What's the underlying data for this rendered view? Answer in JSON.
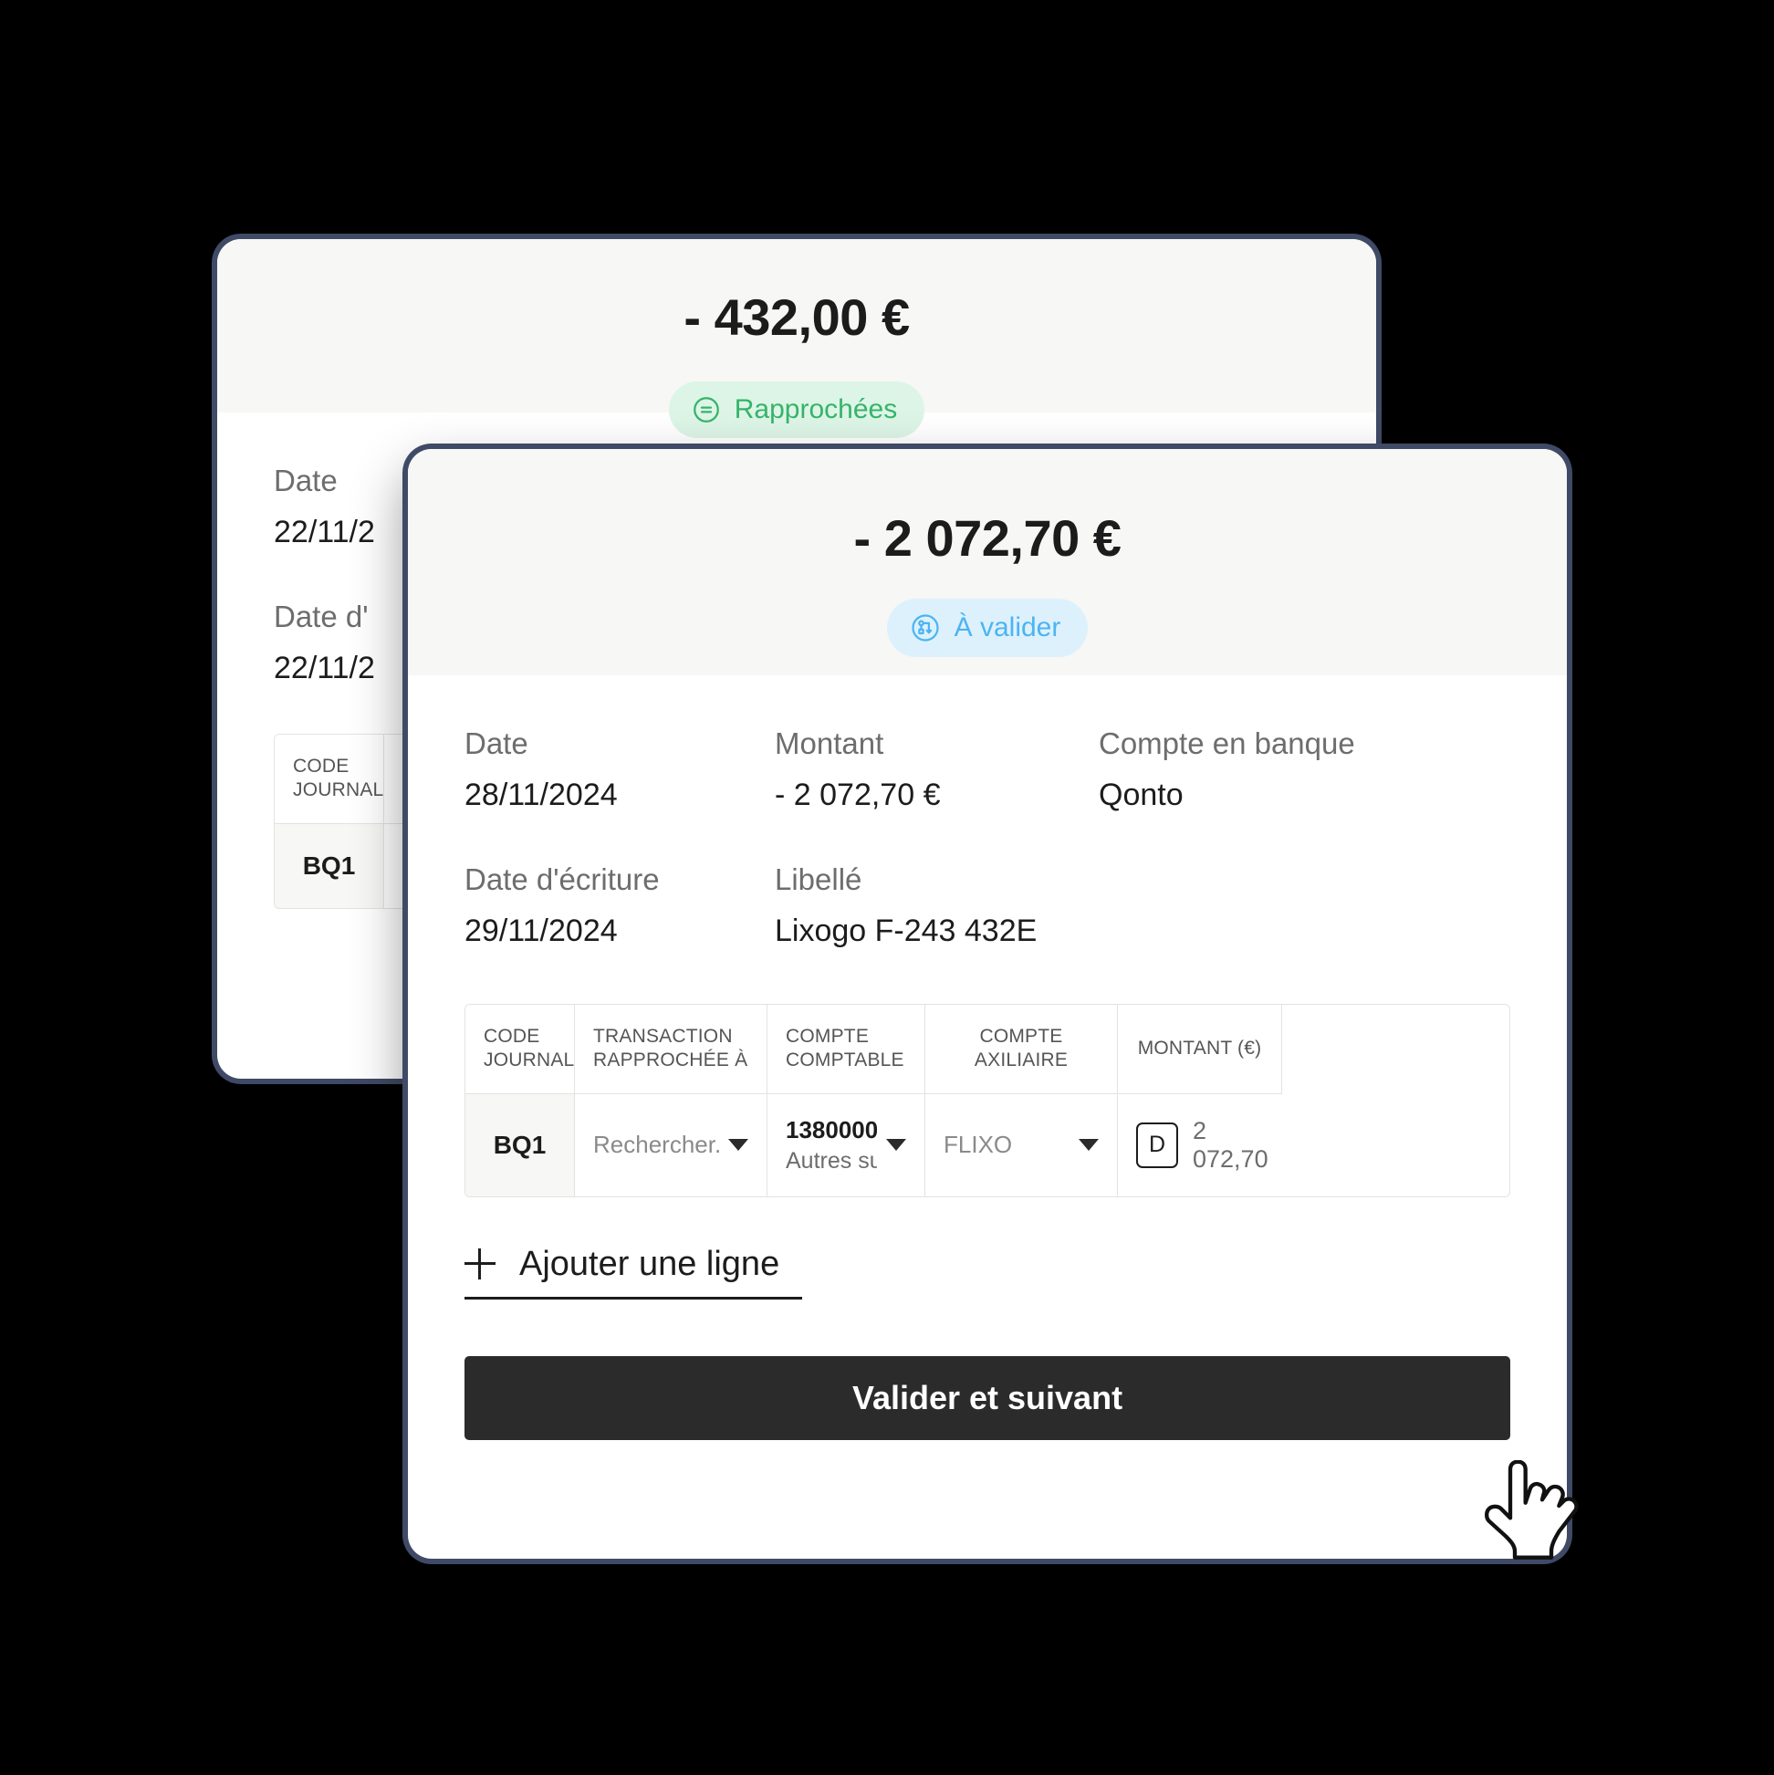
{
  "back_card": {
    "amount": "- 432,00 €",
    "status_badge": {
      "label": "Rapprochées",
      "icon": "equals-circle-icon",
      "color": "#36b46b",
      "bg": "#ddf5e6"
    },
    "fields": [
      {
        "label": "Date",
        "value": "22/11/2"
      },
      {
        "label": "Date d'",
        "value": "22/11/2"
      }
    ],
    "table": {
      "headers": [
        "CODE JOURNAL"
      ],
      "rows": [
        {
          "journal": "BQ1"
        }
      ]
    }
  },
  "front_card": {
    "amount": "- 2 072,70 €",
    "status_badge": {
      "label": "À valider",
      "icon": "workflow-circle-icon",
      "color": "#4cb4f2",
      "bg": "#ddf1fd"
    },
    "fields": [
      {
        "label": "Date",
        "value": "28/11/2024"
      },
      {
        "label": "Montant",
        "value": "- 2 072,70 €"
      },
      {
        "label": "Compte en banque",
        "value": "Qonto"
      },
      {
        "label": "Date d'écriture",
        "value": "29/11/2024"
      },
      {
        "label": "Libellé",
        "value": "Lixogo F-243 432E"
      }
    ],
    "table": {
      "headers": [
        "CODE JOURNAL",
        "TRANSACTION RAPPROCHÉE À",
        "COMPTE COMPTABLE",
        "COMPTE  AXILIAIRE",
        "MONTANT (€)"
      ],
      "rows": [
        {
          "journal": "BQ1",
          "transaction_placeholder": "Rechercher...",
          "account_code": "1380000",
          "account_name": "Autres su...",
          "auxiliary": "FLIXO",
          "debit_credit": "D",
          "amount": "2 072,70"
        }
      ]
    },
    "add_line": {
      "label": "Ajouter une ligne",
      "icon": "plus-icon"
    },
    "validate_button": {
      "label": "Valider et suivant"
    }
  },
  "cursor": {
    "icon": "pointing-hand-cursor"
  }
}
